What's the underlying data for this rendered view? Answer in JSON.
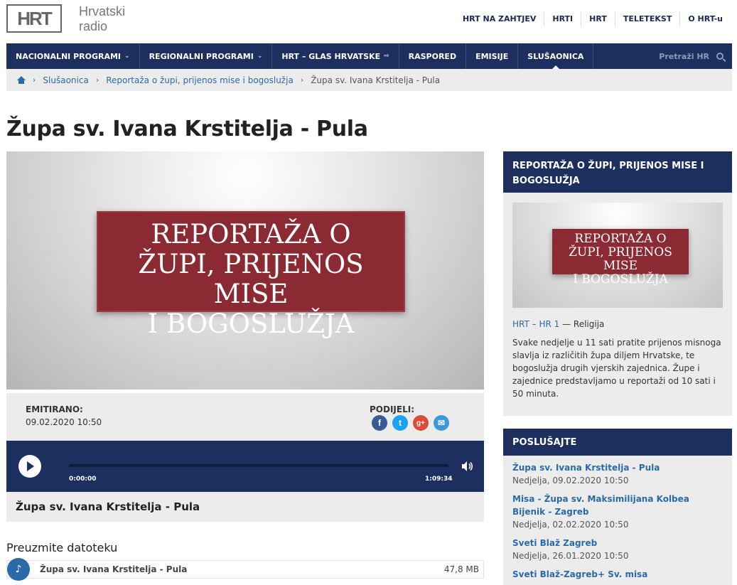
{
  "header": {
    "logo_mark": "HRT",
    "logo_line1": "Hrvatski",
    "logo_line2": "radio",
    "links": [
      "HRT NA ZAHTJEV",
      "HRTI",
      "HRT",
      "TELETEKST",
      "O HRT-u"
    ]
  },
  "nav": {
    "items": [
      {
        "label": "NACIONALNI PROGRAMI",
        "icon": "chevron-down-icon"
      },
      {
        "label": "REGIONALNI PROGRAMI",
        "icon": "chevron-down-icon"
      },
      {
        "label": "HRT – GLAS HRVATSKE",
        "icon": "external-link-icon"
      },
      {
        "label": "RASPORED"
      },
      {
        "label": "EMISIJE"
      },
      {
        "label": "SLUŠAONICA",
        "active": true
      }
    ],
    "search_label": "Pretraži HR"
  },
  "breadcrumb": {
    "items": [
      "Slušaonica",
      "Reportaža o župi, prijenos mise i bogoslužja"
    ],
    "current": "Župa sv. Ivana Krstitelja - Pula"
  },
  "page": {
    "title": "Župa sv. Ivana Krstitelja - Pula",
    "banner_lines": [
      "REPORTAŽA O",
      "ŽUPI, PRIJENOS MISE",
      "I BOGOSLUŽJA"
    ]
  },
  "meta": {
    "aired_label": "EMITIRANO:",
    "aired_value": "09.02.2020 10:50",
    "share_label": "PODIJELI:",
    "share_icons": [
      {
        "name": "facebook-icon",
        "glyph": "f",
        "color": "#3b5998"
      },
      {
        "name": "twitter-icon",
        "glyph": "t",
        "color": "#1da1f2"
      },
      {
        "name": "google-plus-icon",
        "glyph": "g+",
        "color": "#dd4b39"
      },
      {
        "name": "email-icon",
        "glyph": "✉",
        "color": "#3a9ad9"
      }
    ]
  },
  "player": {
    "current_time": "0:00:00",
    "duration": "1:09:34",
    "title": "Župa sv. Ivana Krstitelja - Pula"
  },
  "download": {
    "heading": "Preuzmite datoteku",
    "file_name": "Župa sv. Ivana Krstitelja - Pula",
    "file_size": "47,8 MB"
  },
  "sidebar": {
    "show_title": "REPORTAŽA O ŽUPI, PRIJENOS MISE I BOGOSLUŽJA",
    "thumb_lines": [
      "REPORTAŽA O",
      "ŽUPI, PRIJENOS MISE",
      "I BOGOSLUŽJA"
    ],
    "channel": "HRT – HR 1",
    "category_sep": " — ",
    "category": "Religija",
    "description": "Svake nedjelje u 11 sati pratite prijenos misnoga slavlja iz različitih župa diljem Hrvatske, te bogoslužja drugih vjerskih zajednica. Župe i zajednice predstavljamo u reportaži od 10 sati i 50 minuta.",
    "listen_title": "POSLUŠAJTE",
    "listen_items": [
      {
        "title": "Župa sv. Ivana Krstitelja - Pula",
        "date": "Nedjelja, 09.02.2020 10:50"
      },
      {
        "title": "Misa - Župa sv. Maksimilijana Kolbea Bijenik - Zagreb",
        "date": "Nedjelja, 02.02.2020 10:50"
      },
      {
        "title": "Sveti Blaž Zagreb",
        "date": "Nedjelja, 26.01.2020 10:50"
      },
      {
        "title": "Sveti Blaž-Zagreb+ Sv. misa",
        "date": ""
      }
    ]
  }
}
